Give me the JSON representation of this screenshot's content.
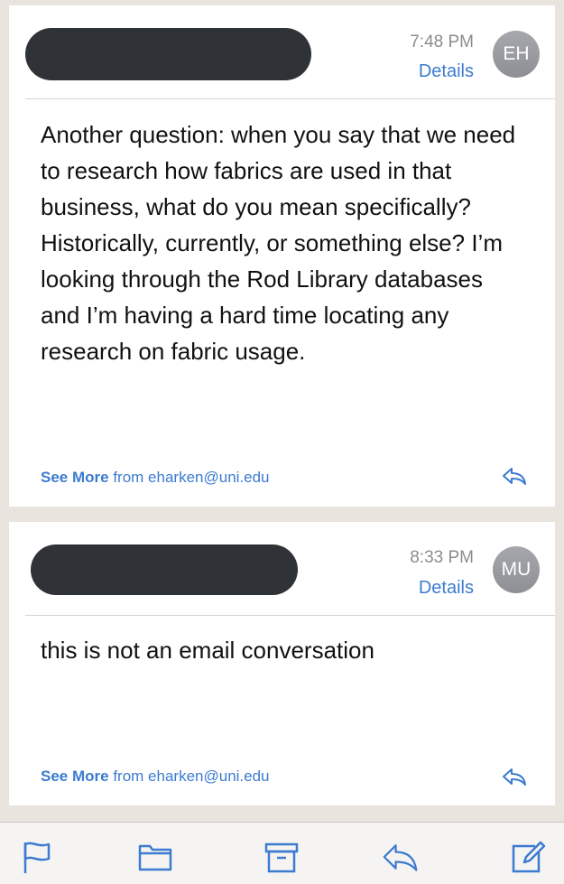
{
  "messages": [
    {
      "time": "7:48 PM",
      "details_label": "Details",
      "avatar_initials": "EH",
      "body": "Another question: when you say that we need to research how fabrics are used in that business, what do you mean specifically? Historically, currently, or something else? I’m looking through the Rod Library databases and I’m having a hard time locating any research on fabric usage.",
      "see_more_label": "See More",
      "from_text": "from eharken@uni.edu",
      "reply_icon": "reply-icon"
    },
    {
      "time": "8:33 PM",
      "details_label": "Details",
      "avatar_initials": "MU",
      "body": "this is not an email conversation",
      "see_more_label": "See More",
      "from_text": "from eharken@uni.edu",
      "reply_icon": "reply-icon"
    }
  ],
  "toolbar": {
    "icons": [
      "flag-icon",
      "folder-icon",
      "archive-icon",
      "reply-icon",
      "compose-icon"
    ]
  },
  "colors": {
    "accent": "#3d7bd0",
    "redaction": "#2f3236",
    "avatar": "#9a9ca1"
  }
}
